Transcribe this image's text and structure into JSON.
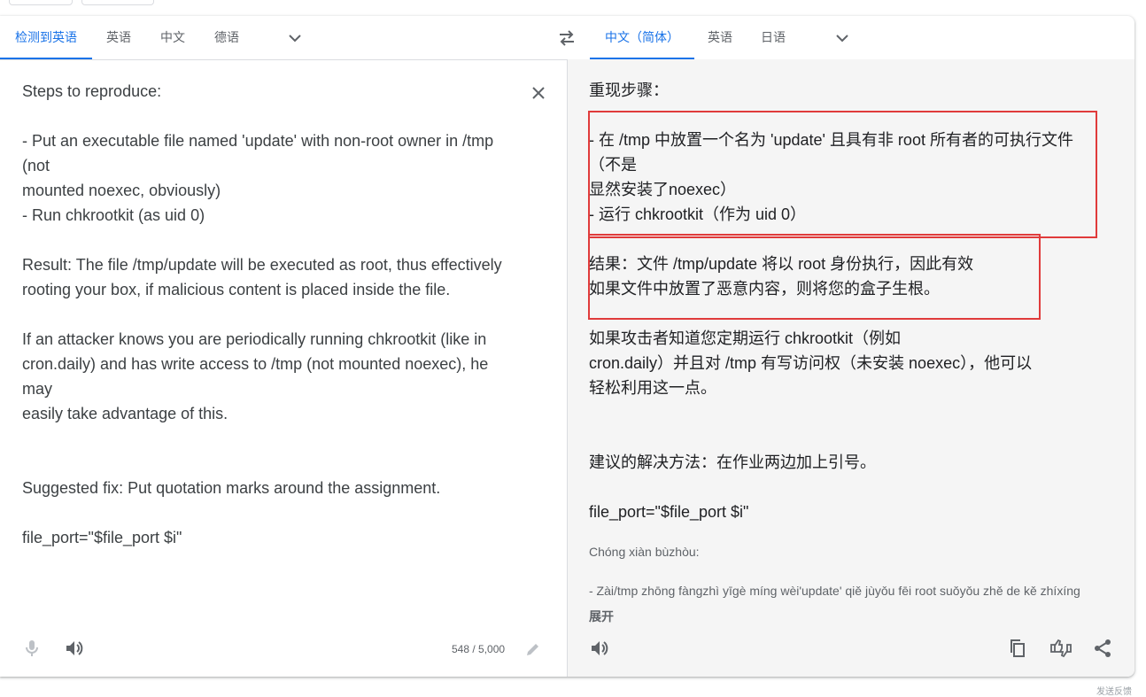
{
  "source_langs": {
    "tabs": [
      "检测到英语",
      "英语",
      "中文",
      "德语"
    ],
    "active_index": 0
  },
  "target_langs": {
    "tabs": [
      "中文（简体）",
      "英语",
      "日语"
    ],
    "active_index": 0
  },
  "source_text": "Steps to reproduce:\n\n- Put an executable file named 'update' with non-root owner in /tmp\n(not\nmounted noexec, obviously)\n- Run chkrootkit (as uid 0)\n\nResult: The file /tmp/update will be executed as root, thus effectively\nrooting your box, if malicious content is placed inside the file.\n\nIf an attacker knows you are periodically running chkrootkit (like in\ncron.daily) and has write access to /tmp (not mounted noexec), he\nmay\neasily take advantage of this.\n\n\nSuggested fix: Put quotation marks around the assignment.\n\nfile_port=\"$file_port $i\"",
  "char_count": "548 / 5,000",
  "target_text": "重现步骤：\n\n- 在 /tmp 中放置一个名为 'update' 且具有非 root 所有者的可执行文件\n（不是\n显然安装了noexec）\n- 运行 chkrootkit（作为 uid 0）\n\n结果：文件 /tmp/update 将以 root 身份执行，因此有效\n如果文件中放置了恶意内容，则将您的盒子生根。\n\n如果攻击者知道您定期运行 chkrootkit（例如\ncron.daily）并且对 /tmp 有写访问权（未安装 noexec），他可以\n轻松利用这一点。\n\n\n建议的解决方法：在作业两边加上引号。\n\nfile_port=\"$file_port $i\"",
  "transliteration": {
    "line1": "Chóng xiàn bùzhòu:",
    "line2": "- Zài/tmp zhōng fàngzhì yīgè míng wèi'update' qiě jùyǒu fēi root suǒyǒu zhě de kě zhíxíng"
  },
  "expand_label": "展开",
  "footer_hint": "发送反馈",
  "colors": {
    "accent": "#1a73e8",
    "highlight_box": "#e03b3b",
    "target_bg": "#f5f5f5"
  },
  "icons": [
    "chevron-down-icon",
    "swap-languages-icon",
    "close-icon",
    "microphone-icon",
    "speaker-icon",
    "pencil-icon",
    "copy-icon",
    "rate-translation-icon",
    "share-icon"
  ]
}
